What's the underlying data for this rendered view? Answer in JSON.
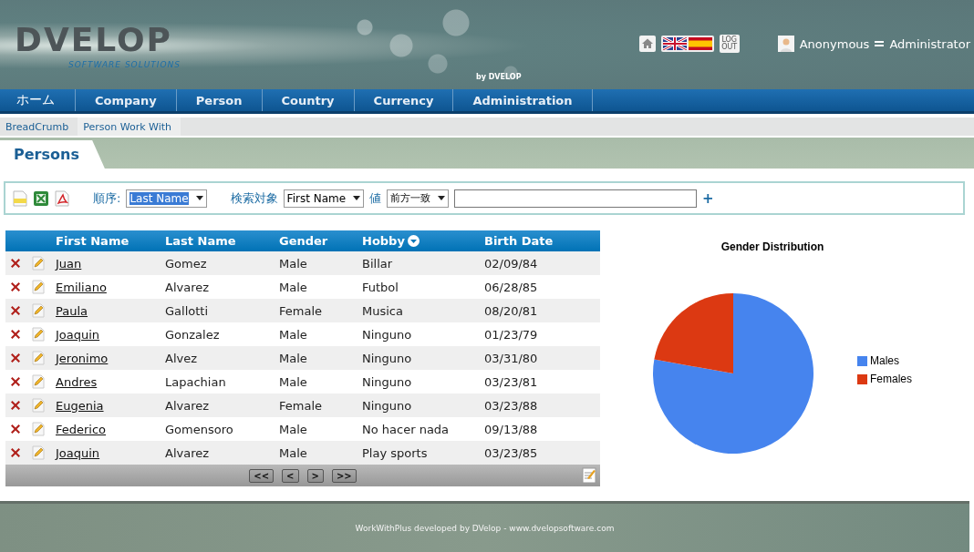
{
  "header": {
    "logo": "DVELOP",
    "logo_tagline": "SOFTWARE SOLUTIONS",
    "powered_by": "by DVELOP",
    "logout": "LOG OUT",
    "user": "Anonymous",
    "role": "Administrator"
  },
  "menu": [
    "ホーム",
    "Company",
    "Person",
    "Country",
    "Currency",
    "Administration"
  ],
  "breadcrumb": [
    "BreadCrumb",
    "Person Work With"
  ],
  "page_title": "Persons",
  "filter": {
    "order_label": "順序:",
    "order_value": "Last Name",
    "search_label": "検索対象",
    "search_field": "First Name",
    "value_label": "値",
    "match_mode": "前方一致",
    "add": "+"
  },
  "table": {
    "columns": [
      {
        "label": "First Name",
        "sorted": false
      },
      {
        "label": "Last Name",
        "sorted": false
      },
      {
        "label": "Gender",
        "sorted": false
      },
      {
        "label": "Hobby",
        "sorted": true
      },
      {
        "label": "Birth Date",
        "sorted": false
      }
    ],
    "rows": [
      [
        "Juan",
        "Gomez",
        "Male",
        "Billar",
        "02/09/84"
      ],
      [
        "Emiliano",
        "Alvarez",
        "Male",
        "Futbol",
        "06/28/85"
      ],
      [
        "Paula",
        "Gallotti",
        "Female",
        "Musica",
        "08/20/81"
      ],
      [
        "Joaquin",
        "Gonzalez",
        "Male",
        "Ninguno",
        "01/23/79"
      ],
      [
        "Jeronimo",
        "Alvez",
        "Male",
        "Ninguno",
        "03/31/80"
      ],
      [
        "Andres",
        "Lapachian",
        "Male",
        "Ninguno",
        "03/23/81"
      ],
      [
        "Eugenia",
        "Alvarez",
        "Female",
        "Ninguno",
        "03/23/88"
      ],
      [
        "Federico",
        "Gomensoro",
        "Male",
        "No hacer nada",
        "09/13/88"
      ],
      [
        "Joaquin",
        "Alvarez",
        "Male",
        "Play sports",
        "03/23/85"
      ]
    ],
    "pager": [
      "<<",
      "<",
      ">",
      ">>"
    ]
  },
  "chart": {
    "chart_data": {
      "type": "pie",
      "title": "Gender Distribution",
      "categories": [
        "Males",
        "Females"
      ],
      "values": [
        77.8,
        22.2
      ],
      "legend": "right",
      "colors": [
        "#4684ee",
        "#dc3912"
      ]
    }
  },
  "footer": "WorkWithPlus developed by DVelop - www.dvelopsoftware.com"
}
